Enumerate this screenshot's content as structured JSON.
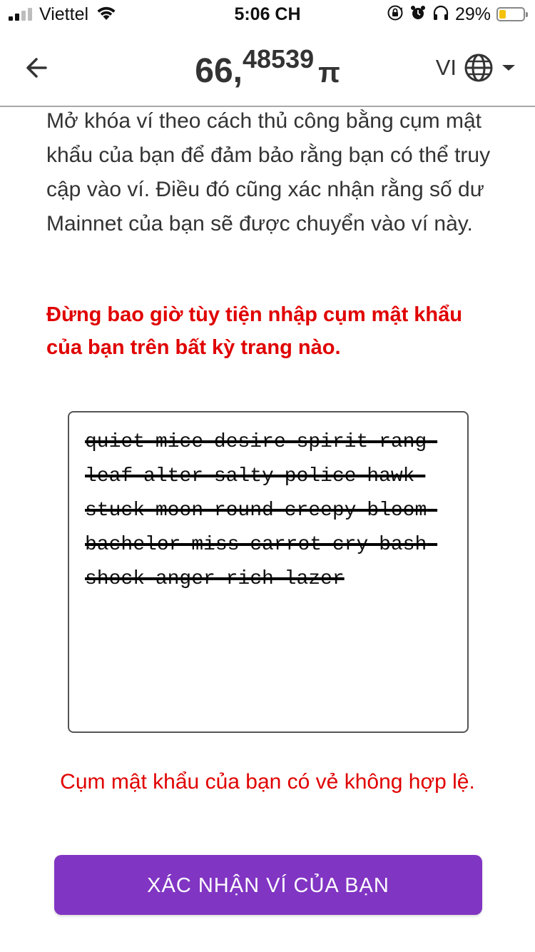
{
  "status_bar": {
    "carrier": "Viettel",
    "time": "5:06 CH",
    "battery_percent": "29%",
    "battery_level": 0.29,
    "signal_bars_active": 2,
    "signal_bars_total": 4,
    "icons": [
      "signal-icon",
      "wifi-icon",
      "orientation-lock-icon",
      "alarm-icon",
      "headphones-icon",
      "battery-icon"
    ]
  },
  "header": {
    "balance_integer": "66,",
    "balance_decimal": "48539",
    "currency_symbol": "π",
    "language_code": "VI",
    "icons": [
      "back-arrow-icon",
      "globe-icon",
      "dropdown-caret-icon"
    ]
  },
  "main": {
    "intro_text": "Mở khóa ví theo cách thủ công bằng cụm mật khẩu của bạn để đảm bảo rằng bạn có thể truy cập vào ví. Điều đó cũng xác nhận rằng số dư Mainnet của bạn sẽ được chuyển vào ví này.",
    "warning_text": "Đừng bao giờ tùy tiện nhập cụm mật khẩu của bạn trên bất kỳ trang nào.",
    "passphrase_value": "quiet mice desire spirit rang leaf alter salty police hawk stuck moon round creepy bloom bachelor miss carrot cry bash shock anger rich lazer",
    "error_text": "Cụm mật khẩu của bạn có vẻ không hợp lệ.",
    "confirm_label": "XÁC NHẬN VÍ CỦA BẠN"
  },
  "colors": {
    "accent": "#8135c3",
    "error": "#e00000",
    "text": "#333333",
    "battery": "#f4c20d"
  }
}
